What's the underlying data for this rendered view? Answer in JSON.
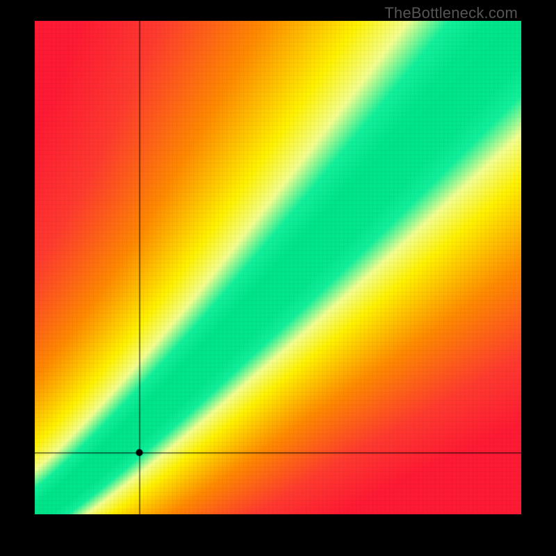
{
  "watermark": "TheBottleneck.com",
  "chart_data": {
    "type": "heatmap",
    "title": "",
    "xlabel": "",
    "ylabel": "",
    "xlim": [
      0,
      1
    ],
    "ylim": [
      0,
      1
    ],
    "description": "2D bottleneck heatmap. Color encodes match quality between two normalized performance axes: green along the diagonal band (balanced), yellow near-diagonal, red/orange far from diagonal. A black marker with crosshairs indicates the current configuration point.",
    "diagonal_band": {
      "center_slope": 1.0,
      "band_halfwidth": 0.07,
      "curve_exponent": 1.12
    },
    "marker": {
      "x": 0.215,
      "y": 0.125
    },
    "colors": {
      "deep_red": "#ff1a33",
      "red": "#ff3b2f",
      "orange": "#ff8a00",
      "yellow": "#fff200",
      "lightyellow": "#f4ff8f",
      "green": "#00e58a",
      "mint": "#12f19b"
    }
  }
}
